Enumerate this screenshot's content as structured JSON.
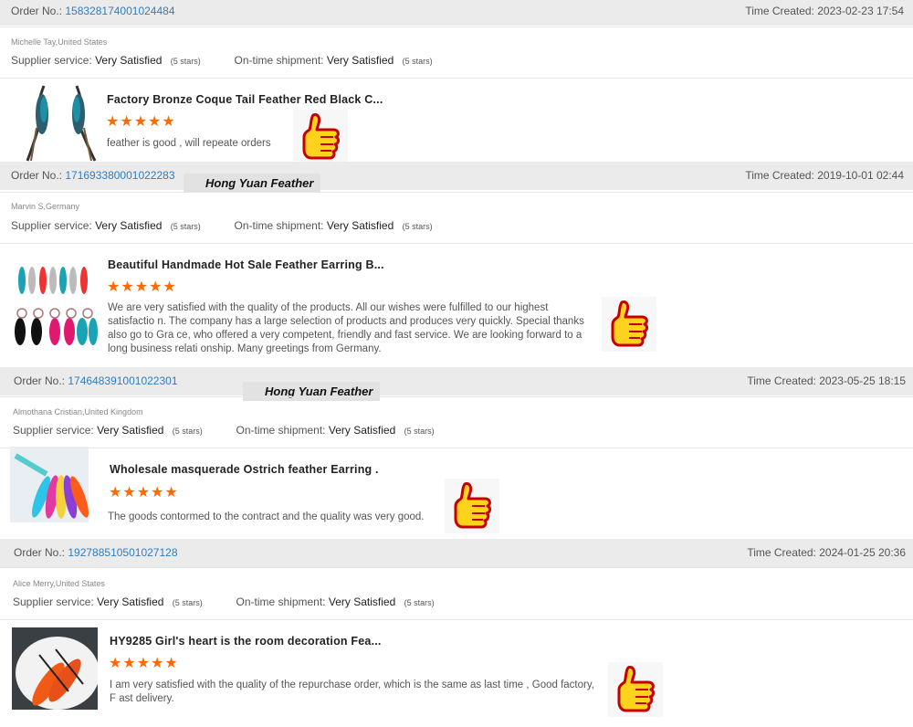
{
  "labels": {
    "order_no": "Order No.:",
    "time_created": "Time Created:",
    "supplier_service": "Supplier service:",
    "ontime_shipment": "On-time shipment:"
  },
  "watermark": "Hong Yuan Feather",
  "orders": [
    {
      "order_no": "158328174001024484",
      "time_created": "2023-02-23 17:54",
      "buyer": "Michelle Tay,United States",
      "supplier_service": "Very Satisfied",
      "supplier_stars": "(5 stars)",
      "shipment": "Very Satisfied",
      "shipment_stars": "(5 stars)",
      "product_title": "Factory Bronze Coque Tail Feather Red Black C...",
      "rating": "★★★★★",
      "review": "feather is good , will repeate orders"
    },
    {
      "order_no": "171693380001022283",
      "time_created": "2019-10-01 02:44",
      "buyer": "Marvin S,Germany",
      "supplier_service": "Very Satisfied",
      "supplier_stars": "(5 stars)",
      "shipment": "Very Satisfied",
      "shipment_stars": "(5 stars)",
      "product_title": "Beautiful Handmade Hot Sale Feather Earring B...",
      "rating": "★★★★★",
      "review": "We are very satisfied with the quality of the products. All our wishes were fulfilled to our highest satisfactio n. The company has a large selection of products and produces very quickly. Special thanks also go to Gra ce, who offered a very competent, friendly and fast service. We are looking forward to a long business relati onship. Many greetings from Germany."
    },
    {
      "order_no": "174648391001022301",
      "time_created": "2023-05-25 18:15",
      "buyer": "Almothana Cristian,United Kingdom",
      "supplier_service": "Very Satisfied",
      "supplier_stars": "(5 stars)",
      "shipment": "Very Satisfied",
      "shipment_stars": "(5 stars)",
      "product_title": "Wholesale masquerade Ostrich feather Earring .",
      "rating": "★★★★★",
      "review": "The goods contormed to the contract and the quality was very good."
    },
    {
      "order_no": "192788510501027128",
      "time_created": "2024-01-25 20:36",
      "buyer": "Alice Merry,United States",
      "supplier_service": "Very Satisfied",
      "supplier_stars": "(5 stars)",
      "shipment": "Very Satisfied",
      "shipment_stars": "(5 stars)",
      "product_title": "HY9285 Girl's heart is the room decoration Fea...",
      "rating": "★★★★★",
      "review": "I am very satisfied with the quality of the repurchase order, which is the same as last time , Good factory, F ast delivery."
    }
  ]
}
